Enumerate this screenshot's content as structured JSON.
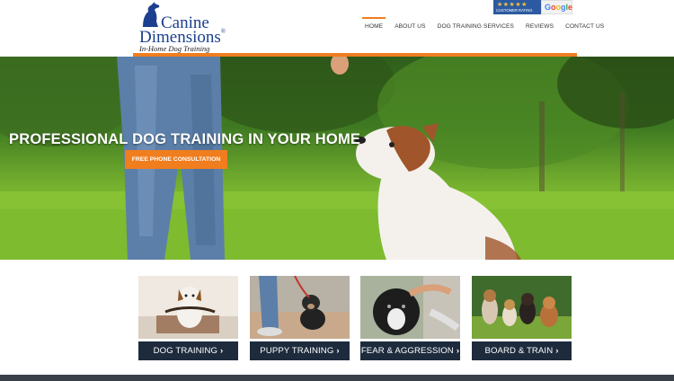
{
  "logo": {
    "line1": "Canine",
    "line2": "Dimensions",
    "registered": "®",
    "tagline": "In-Home Dog Training"
  },
  "nav": {
    "items": [
      {
        "label": "HOME",
        "active": true
      },
      {
        "label": "ABOUT US",
        "active": false
      },
      {
        "label": "DOG TRAINING SERVICES",
        "active": false
      },
      {
        "label": "REVIEWS",
        "active": false
      },
      {
        "label": "CONTACT US",
        "active": false
      }
    ]
  },
  "rating": {
    "stars": "★★★★★",
    "label": "CUSTOMER RATING",
    "google": {
      "g": "G",
      "o1": "o",
      "o2": "o",
      "g2": "g",
      "l": "l",
      "e": "e"
    }
  },
  "hero": {
    "title": "PROFESSIONAL DOG TRAINING IN YOUR HOME",
    "cta": "FREE PHONE CONSULTATION"
  },
  "services": [
    {
      "label": "DOG TRAINING",
      "chevron": "›"
    },
    {
      "label": "PUPPY TRAINING",
      "chevron": "›"
    },
    {
      "label": "FEAR & AGGRESSION",
      "chevron": "›"
    },
    {
      "label": "BOARD & TRAIN",
      "chevron": "›"
    }
  ],
  "colors": {
    "accent": "#f07d1e",
    "brand_blue": "#1c3f8f",
    "button_dark": "#1d2b3d"
  }
}
